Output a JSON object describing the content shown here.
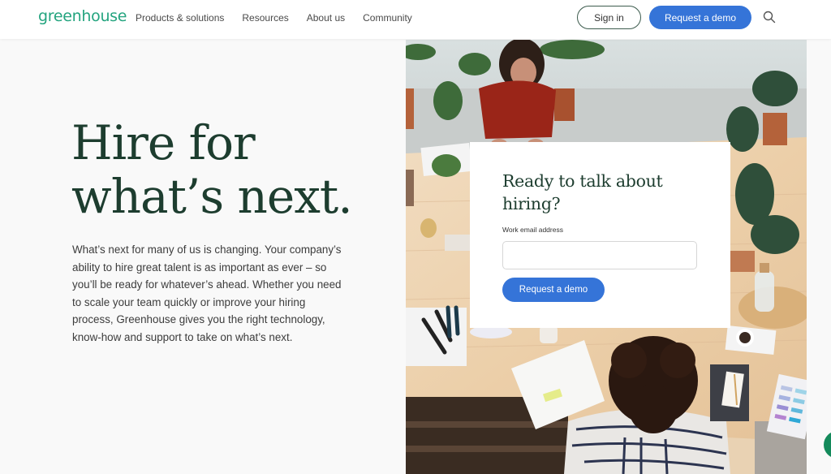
{
  "header": {
    "logo": "greenhouse",
    "nav": [
      {
        "label": "Products & solutions"
      },
      {
        "label": "Resources"
      },
      {
        "label": "About us"
      },
      {
        "label": "Community"
      }
    ],
    "sign_in_label": "Sign in",
    "request_demo_label": "Request a demo",
    "search_icon": "search-icon"
  },
  "hero": {
    "title_line1": "Hire for",
    "title_line2": "what’s next.",
    "body": "What’s next for many of us is changing. Your company’s ability to hire great talent is as important as ever – so you’ll be ready for whatever’s ahead. Whether you need to scale your team quickly or improve your hiring process, Greenhouse gives you the right technology, know-how and support to take on what’s next."
  },
  "form": {
    "title": "Ready to talk about hiring?",
    "email_label": "Work email address",
    "email_value": "",
    "email_placeholder": "",
    "submit_label": "Request a demo"
  },
  "photo": {
    "description": "Overhead view of two women working at a wooden table surrounded by potted plants"
  },
  "colors": {
    "brand_green": "#24a47f",
    "heading_green": "#1d3d2f",
    "button_blue": "#3574d8",
    "chat_green": "#148a5b"
  }
}
